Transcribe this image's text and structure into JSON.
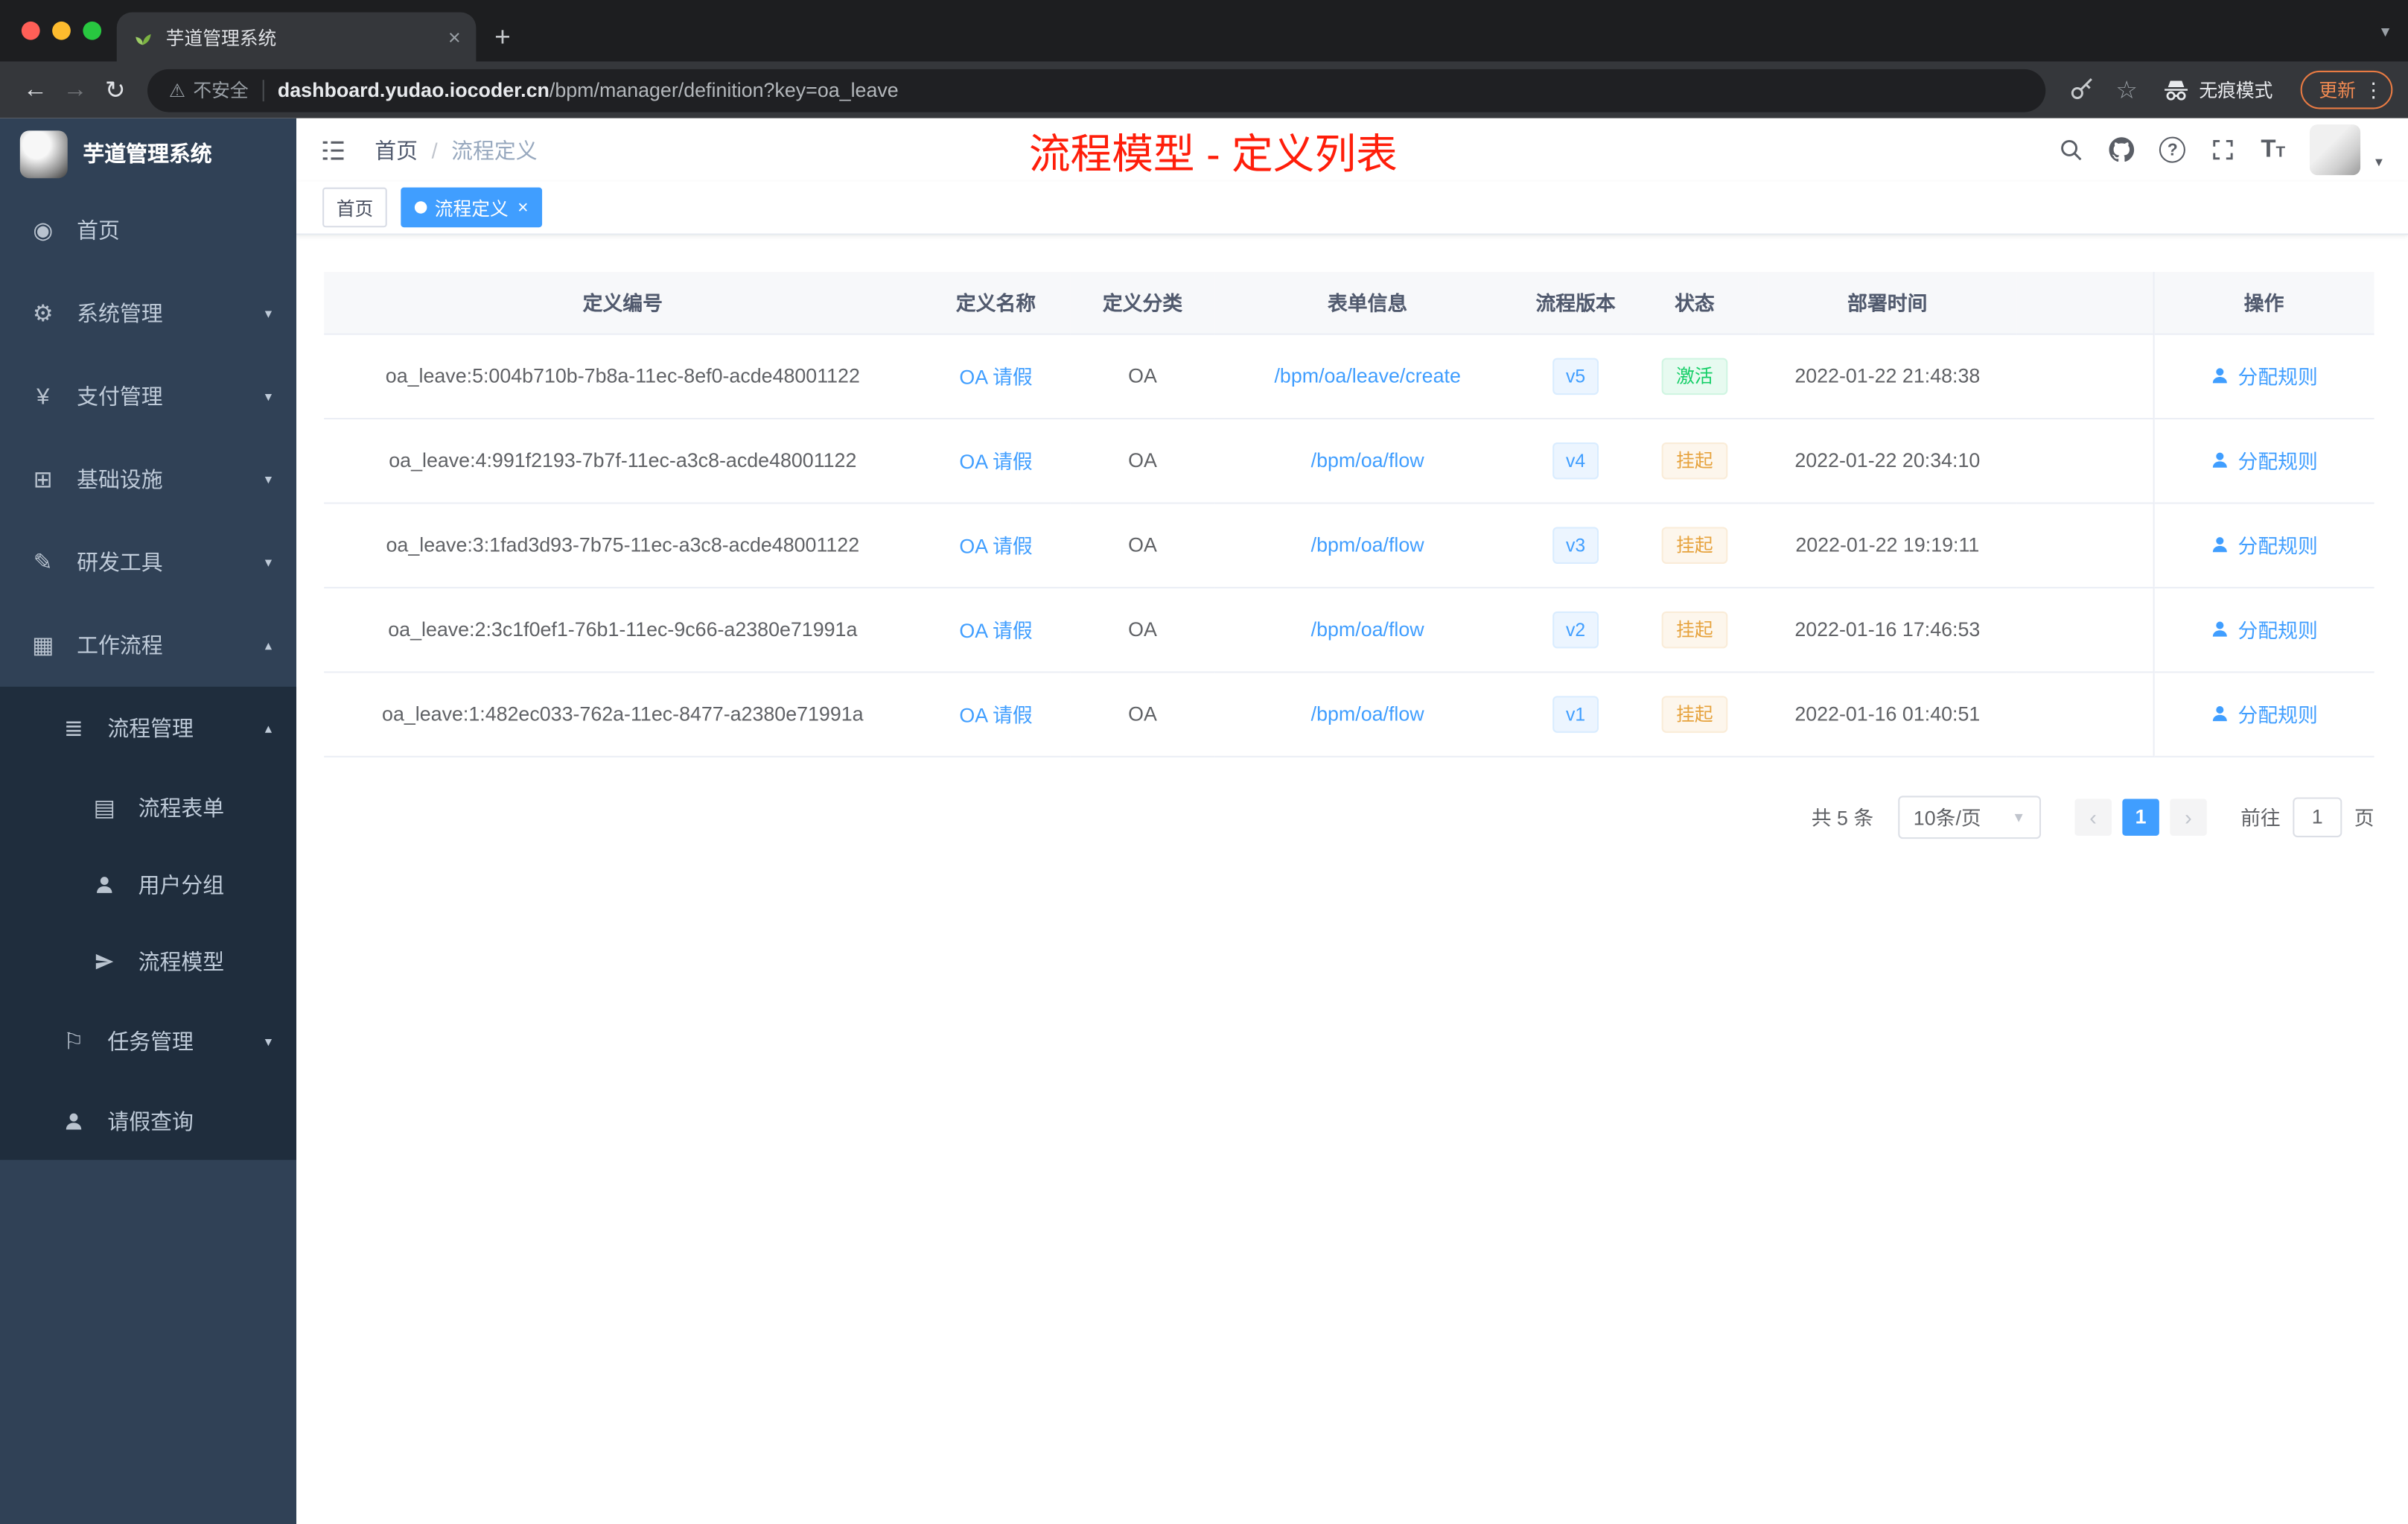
{
  "colors": {
    "accent": "#409eff",
    "success": "#13ce66",
    "warning": "#e6a23c",
    "annotation_red": "#ff1e0a",
    "sidebar_bg": "#304156",
    "sidebar_submenu_bg": "#1f2d3d"
  },
  "browser": {
    "tab_title": "芋道管理系统",
    "security_label": "不安全",
    "url_domain": "dashboard.yudao.iocoder.cn",
    "url_path": "/bpm/manager/definition?key=oa_leave",
    "incognito_label": "无痕模式",
    "update_label": "更新"
  },
  "sidebar": {
    "logo_title": "芋道管理系统",
    "items": [
      {
        "label": "首页",
        "icon": "dashboard-icon"
      },
      {
        "label": "系统管理",
        "icon": "gear-icon"
      },
      {
        "label": "支付管理",
        "icon": "payment-icon"
      },
      {
        "label": "基础设施",
        "icon": "infrastructure-icon"
      },
      {
        "label": "研发工具",
        "icon": "dev-tools-icon"
      },
      {
        "label": "工作流程",
        "icon": "workflow-icon"
      }
    ],
    "submenu_parent": "流程管理",
    "submenu_children": [
      "流程表单",
      "用户分组",
      "流程模型"
    ],
    "task_mgmt": "任务管理",
    "leave_query": "请假查询"
  },
  "header": {
    "breadcrumb_home": "首页",
    "breadcrumb_separator": "/",
    "breadcrumb_current": "流程定义",
    "annotation": "流程模型 - 定义列表"
  },
  "tags": {
    "home": "首页",
    "active": "流程定义"
  },
  "table": {
    "columns": [
      "定义编号",
      "定义名称",
      "定义分类",
      "表单信息",
      "流程版本",
      "状态",
      "部署时间",
      "操作"
    ],
    "rows": [
      {
        "id": "oa_leave:5:004b710b-7b8a-11ec-8ef0-acde48001122",
        "name": "OA 请假",
        "category": "OA",
        "form": "/bpm/oa/leave/create",
        "version": "v5",
        "status": "激活",
        "status_type": "success",
        "time": "2022-01-22 21:48:38",
        "action": "分配规则"
      },
      {
        "id": "oa_leave:4:991f2193-7b7f-11ec-a3c8-acde48001122",
        "name": "OA 请假",
        "category": "OA",
        "form": "/bpm/oa/flow",
        "version": "v4",
        "status": "挂起",
        "status_type": "warning",
        "time": "2022-01-22 20:34:10",
        "action": "分配规则"
      },
      {
        "id": "oa_leave:3:1fad3d93-7b75-11ec-a3c8-acde48001122",
        "name": "OA 请假",
        "category": "OA",
        "form": "/bpm/oa/flow",
        "version": "v3",
        "status": "挂起",
        "status_type": "warning",
        "time": "2022-01-22 19:19:11",
        "action": "分配规则"
      },
      {
        "id": "oa_leave:2:3c1f0ef1-76b1-11ec-9c66-a2380e71991a",
        "name": "OA 请假",
        "category": "OA",
        "form": "/bpm/oa/flow",
        "version": "v2",
        "status": "挂起",
        "status_type": "warning",
        "time": "2022-01-16 17:46:53",
        "action": "分配规则"
      },
      {
        "id": "oa_leave:1:482ec033-762a-11ec-8477-a2380e71991a",
        "name": "OA 请假",
        "category": "OA",
        "form": "/bpm/oa/flow",
        "version": "v1",
        "status": "挂起",
        "status_type": "warning",
        "time": "2022-01-16 01:40:51",
        "action": "分配规则"
      }
    ]
  },
  "pagination": {
    "total": "共 5 条",
    "page_size": "10条/页",
    "current_page": "1",
    "goto_label": "前往",
    "goto_value": "1",
    "unit_label": "页"
  }
}
